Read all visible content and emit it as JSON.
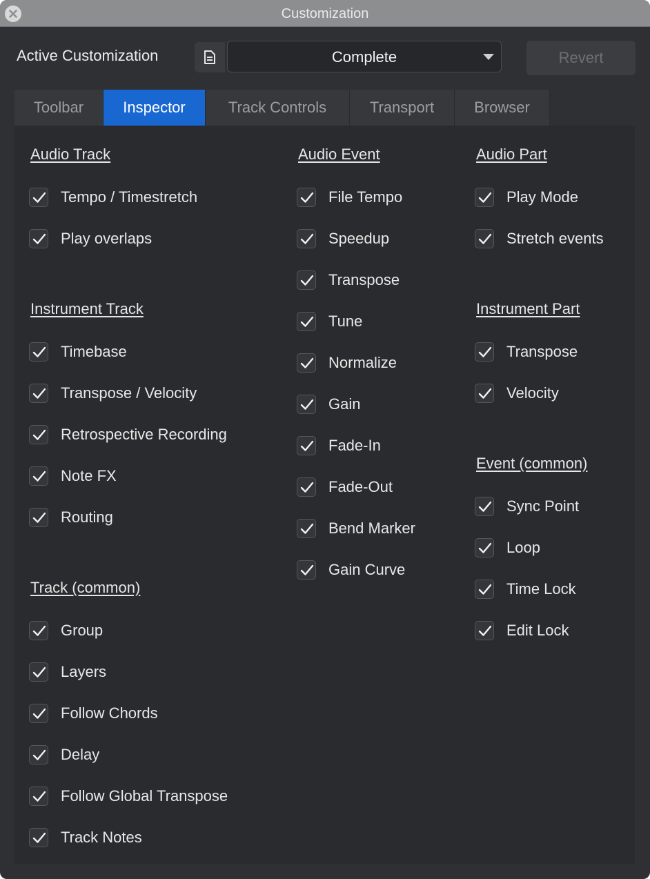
{
  "window": {
    "title": "Customization"
  },
  "toolbar": {
    "active_label": "Active Customization",
    "selected": "Complete",
    "revert_label": "Revert"
  },
  "tabs": [
    {
      "label": "Toolbar",
      "active": false
    },
    {
      "label": "Inspector",
      "active": true
    },
    {
      "label": "Track Controls",
      "active": false
    },
    {
      "label": "Transport",
      "active": false
    },
    {
      "label": "Browser",
      "active": false
    }
  ],
  "sections": {
    "audio_track": {
      "title": "Audio Track",
      "items": [
        "Tempo / Timestretch",
        "Play overlaps"
      ]
    },
    "instrument_track": {
      "title": "Instrument Track",
      "items": [
        "Timebase",
        "Transpose / Velocity",
        "Retrospective Recording",
        "Note FX",
        "Routing"
      ]
    },
    "track_common": {
      "title": "Track (common)",
      "items": [
        "Group",
        "Layers",
        "Follow Chords",
        "Delay",
        "Follow Global Transpose",
        "Track Notes"
      ]
    },
    "audio_event": {
      "title": "Audio Event",
      "items": [
        "File Tempo",
        "Speedup",
        "Transpose",
        "Tune",
        "Normalize",
        "Gain",
        "Fade-In",
        "Fade-Out",
        "Bend Marker",
        "Gain Curve"
      ]
    },
    "audio_part": {
      "title": "Audio Part",
      "items": [
        "Play Mode",
        "Stretch events"
      ]
    },
    "instrument_part": {
      "title": "Instrument Part",
      "items": [
        "Transpose",
        "Velocity"
      ]
    },
    "event_common": {
      "title": "Event (common)",
      "items": [
        "Sync Point",
        "Loop",
        "Time Lock",
        "Edit Lock"
      ]
    }
  },
  "colors": {
    "accent": "#1968d2",
    "background": "#2f3033",
    "panel": "#2a2b2e"
  },
  "icons": {
    "close": "close-icon",
    "file": "document-icon",
    "dropdown": "chevron-down-icon",
    "check": "checkmark-icon"
  }
}
